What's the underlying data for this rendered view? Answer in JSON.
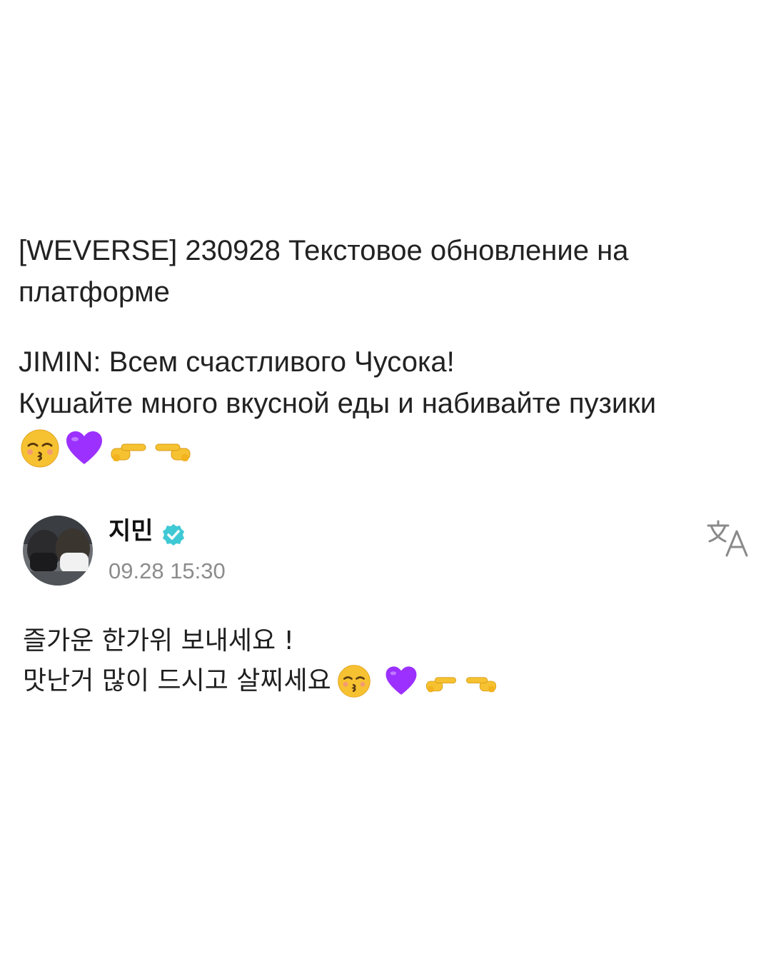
{
  "caption": {
    "headline": "[WEVERSE] 230928 Текстовое обновление на платформе",
    "translation_line1": "JIMIN: Всем счастливого Чусока!",
    "translation_line2": "Кушайте много вкусной еды и набивайте пузики",
    "emojis": [
      "kissing-face-icon",
      "purple-heart-icon",
      "pointing-right-icon",
      "pointing-left-icon"
    ]
  },
  "post": {
    "author": "지민",
    "verified_color": "#3fc9d4",
    "timestamp": "09.28 15:30",
    "body_line1": "즐가운 한가위 보내세요 !",
    "body_line2": "맛난거 많이 드시고 살찌세요",
    "body_emojis": [
      "kissing-face-icon",
      "purple-heart-icon",
      "pointing-right-icon",
      "pointing-left-icon"
    ]
  },
  "colors": {
    "text": "#222222",
    "timestamp": "#8c8c8c",
    "heart": "#9b30ff",
    "emoji_yellow": "#f7c232"
  }
}
